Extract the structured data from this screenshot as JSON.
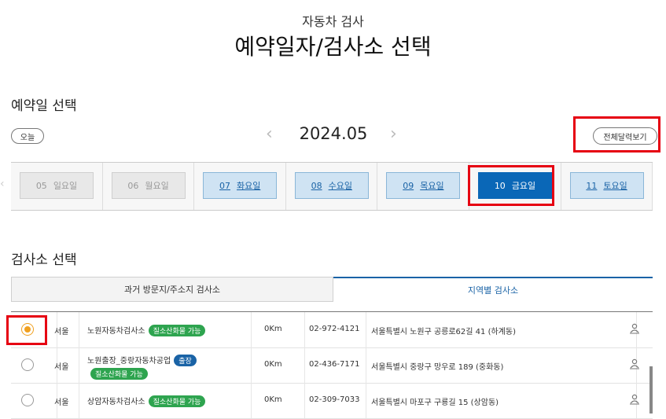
{
  "header": {
    "subtitle": "자동차 검사",
    "title": "예약일자/검사소 선택"
  },
  "date_section": {
    "title": "예약일 선택",
    "today_label": "오늘",
    "month": "2024.05",
    "prev_icon": "chevron-left-icon",
    "next_icon": "chevron-right-icon",
    "full_calendar_label": "전체달력보기",
    "days": [
      {
        "num": "05",
        "weekday": "일요일",
        "state": "disabled"
      },
      {
        "num": "06",
        "weekday": "월요일",
        "state": "disabled"
      },
      {
        "num": "07",
        "weekday": "화요일",
        "state": "available"
      },
      {
        "num": "08",
        "weekday": "수요일",
        "state": "available"
      },
      {
        "num": "09",
        "weekday": "목요일",
        "state": "available"
      },
      {
        "num": "10",
        "weekday": "금요일",
        "state": "selected"
      },
      {
        "num": "11",
        "weekday": "토요일",
        "state": "available"
      }
    ]
  },
  "center_section": {
    "title": "검사소 선택",
    "tabs": [
      {
        "label": "과거 방문지/주소지 검사소",
        "active": false
      },
      {
        "label": "지역별 검사소",
        "active": true
      }
    ],
    "rows": [
      {
        "selected": true,
        "region": "서울",
        "name": "노원자동차검사소",
        "badges": [
          {
            "text": "질소산화물 가능",
            "color": "green"
          }
        ],
        "distance": "0Km",
        "phone": "02-972-4121",
        "address": "서울특별시 노원구 공릉로62길 41 (하계동)",
        "icon": "person-map-icon"
      },
      {
        "selected": false,
        "region": "서울",
        "name": "노원출장_중랑자동차공업",
        "badges": [
          {
            "text": "출장",
            "color": "blue"
          },
          {
            "text": "질소산화물 가능",
            "color": "green"
          }
        ],
        "distance": "0Km",
        "phone": "02-436-7171",
        "address": "서울특별시 중랑구 망우로 189 (중화동)",
        "icon": "person-map-icon"
      },
      {
        "selected": false,
        "region": "서울",
        "name": "상암자동차검사소",
        "badges": [
          {
            "text": "질소산화물 가능",
            "color": "green"
          }
        ],
        "distance": "0Km",
        "phone": "02-309-7033",
        "address": "서울특별시 마포구 구룡길 15 (상암동)",
        "icon": "person-map-icon"
      }
    ]
  },
  "colors": {
    "accent": "#1a63a6",
    "selected_day": "#0a67b7",
    "available_day": "#cfe3f3",
    "highlight": "#e60012",
    "badge_green": "#2ea44f",
    "radio_checked": "#f0a020"
  }
}
